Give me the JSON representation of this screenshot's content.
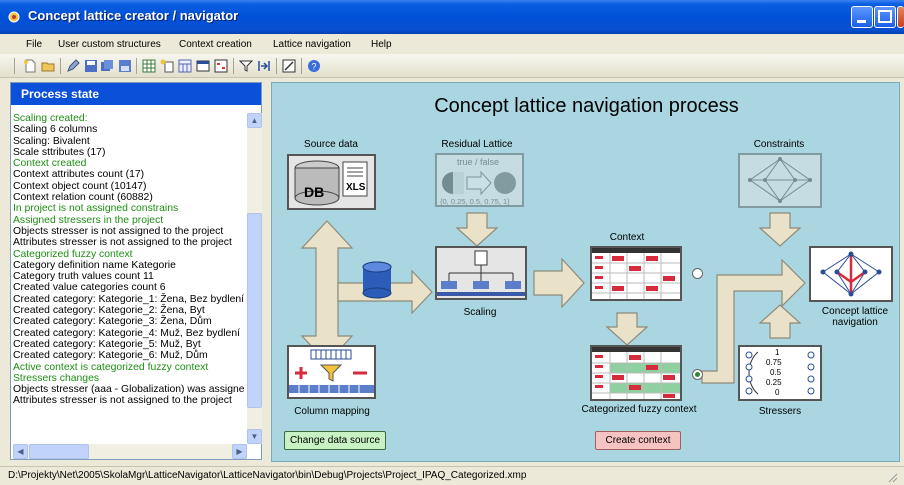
{
  "window": {
    "title": "Concept  lattice creator / navigator"
  },
  "menu": [
    "File",
    "User custom structures",
    "Context creation",
    "Lattice navigation",
    "Help"
  ],
  "process_panel": {
    "header": "Process state",
    "lines": [
      {
        "text": "Scaling created:",
        "green": true
      },
      {
        "text": "Scaling 6 columns",
        "green": false
      },
      {
        "text": "Scaling: Bivalent",
        "green": false
      },
      {
        "text": "Scale sttributes (17)",
        "green": false
      },
      {
        "text": "Context created",
        "green": true
      },
      {
        "text": "Context attributes count (17)",
        "green": false
      },
      {
        "text": "Context object count (10147)",
        "green": false
      },
      {
        "text": "Context relation count (60882)",
        "green": false
      },
      {
        "text": "In project is not assigned constrains",
        "green": true
      },
      {
        "text": "Assigned stressers in the project",
        "green": true
      },
      {
        "text": "Objects stresser is not assigned to the project",
        "green": false
      },
      {
        "text": "Attributes stresser is not assigned to the project",
        "green": false
      },
      {
        "text": "Categorized fuzzy context",
        "green": true
      },
      {
        "text": "Category definition name Kategorie",
        "green": false
      },
      {
        "text": "Category truth values count 11",
        "green": false
      },
      {
        "text": "Created value categories count 6",
        "green": false
      },
      {
        "text": "Created category: Kategorie_1: Žena, Bez bydlení",
        "green": false
      },
      {
        "text": "Created category: Kategorie_2: Žena, Byt",
        "green": false
      },
      {
        "text": "Created category: Kategorie_3: Žena, Dům",
        "green": false
      },
      {
        "text": "Created category: Kategorie_4: Muž, Bez bydlení",
        "green": false
      },
      {
        "text": "Created category: Kategorie_5: Muž, Byt",
        "green": false
      },
      {
        "text": "Created category: Kategorie_6: Muž, Dům",
        "green": false
      },
      {
        "text": "Active context is categorized fuzzy context",
        "green": true
      },
      {
        "text": "Stressers changes",
        "green": true
      },
      {
        "text": "Objects stresser (aaa - Globalization) was assigned",
        "green": false
      },
      {
        "text": "Attributes stresser is not assigned to the project",
        "green": false
      }
    ]
  },
  "main": {
    "title": "Concept lattice navigation process",
    "source_data": "Source data",
    "db_label": "DB",
    "xls_label": "XLS",
    "residual": "Residual Lattice",
    "residual_tf": "true / false",
    "residual_scale": "{0, 0.25, 0.5, 0.75, 1}",
    "constraints": "Constraints",
    "context": "Context",
    "scaling": "Scaling",
    "column_mapping": "Column mapping",
    "categorized": "Categorized fuzzy context",
    "stressers": "Stressers",
    "stress_values": [
      "1",
      "0.75",
      "0.5",
      "0.25",
      "0"
    ],
    "navigation_line1": "Concept    lattice",
    "navigation_line2": "navigation",
    "change_source_btn": "Change data source",
    "create_context_btn": "Create context"
  },
  "status": "D:\\Projekty\\Net\\2005\\SkolaMgr\\LatticeNavigator\\LatticeNavigator\\bin\\Debug\\Projects\\Project_IPAQ_Categorized.xmp",
  "colors": {
    "titlebar": "#0050d8",
    "panel_header": "#0b50d8",
    "log_green": "#1d8f12",
    "canvas": "#a9d6e1"
  }
}
